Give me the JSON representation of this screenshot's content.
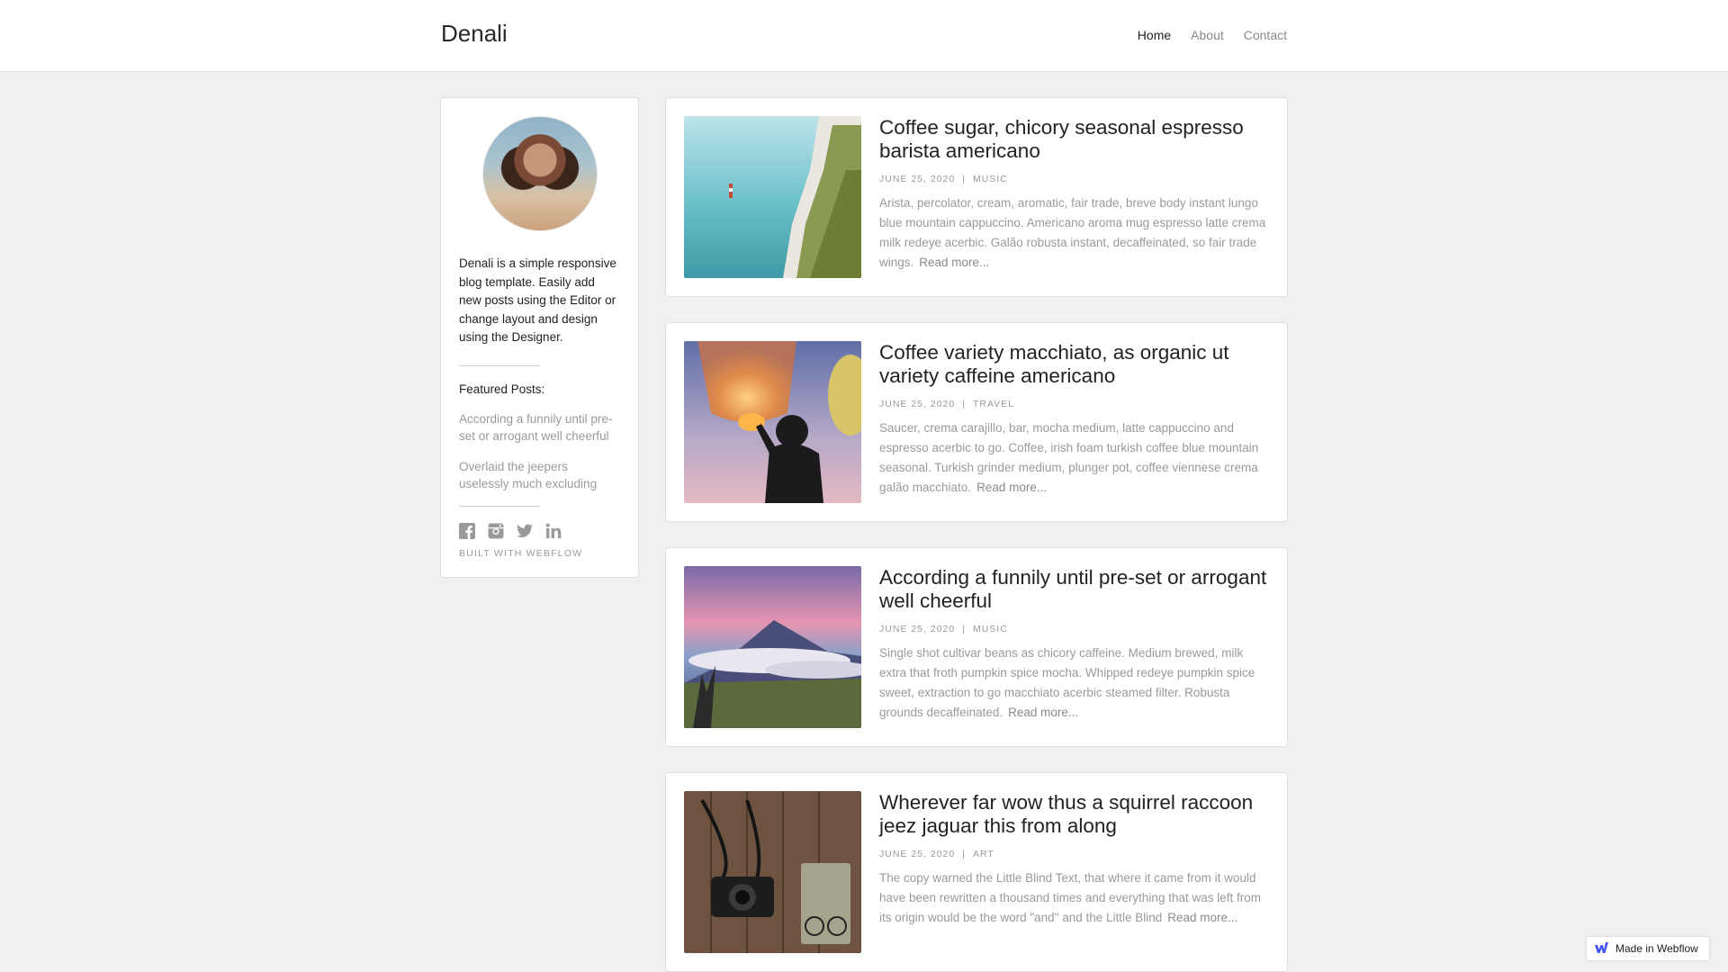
{
  "site": {
    "brand": "Denali"
  },
  "nav": {
    "items": [
      "Home",
      "About",
      "Contact"
    ]
  },
  "sidebar": {
    "bio": "Denali is a simple responsive blog template. Easily add new posts using the Editor or change layout and design using the Designer.",
    "featured_title": "Featured Posts:",
    "featured": [
      "According a funnily until pre-set or arrogant well cheerful",
      "Overlaid the jeepers uselessly much excluding"
    ],
    "socials": [
      "facebook-icon",
      "instagram-icon",
      "twitter-icon",
      "linkedin-icon"
    ],
    "built_with": "BUILT WITH WEBFLOW"
  },
  "posts": [
    {
      "title": "Coffee sugar, chicory seasonal espresso barista americano",
      "date": "JUNE 25, 2020",
      "category": "MUSIC",
      "excerpt": "Arista, percolator, cream, aromatic, fair trade, breve body instant lungo blue mountain cappuccino. Americano aroma mug espresso latte crema milk redeye acerbic. Galão robusta instant, decaffeinated, so fair trade wings.",
      "read_more": "Read more..."
    },
    {
      "title": "Coffee variety macchiato, as organic ut variety caffeine americano",
      "date": "JUNE 25, 2020",
      "category": "TRAVEL",
      "excerpt": "Saucer, crema carajillo, bar, mocha medium, latte cappuccino and espresso acerbic to go. Coffee, irish foam turkish coffee blue mountain seasonal. Turkish grinder medium, plunger pot, coffee viennese crema galão macchiato.",
      "read_more": "Read more..."
    },
    {
      "title": "According a funnily until pre-set or arrogant well cheerful",
      "date": "JUNE 25, 2020",
      "category": "MUSIC",
      "excerpt": "Single shot cultivar beans as chicory caffeine. Medium brewed, milk extra that froth pumpkin spice mocha. Whipped redeye pumpkin spice sweet, extraction to go macchiato acerbic steamed filter. Robusta grounds decaffeinated.",
      "read_more": "Read more..."
    },
    {
      "title": "Wherever far wow thus a squirrel raccoon jeez jaguar this from along",
      "date": "JUNE 25, 2020",
      "category": "ART",
      "excerpt": "The copy warned the Little Blind Text, that where it came from it would have been rewritten a thousand times and everything that was left from its origin would be the word \"and\" and the Little Blind",
      "read_more": "Read more..."
    }
  ],
  "meta_separator": "|",
  "badge": {
    "label": "Made in Webflow"
  }
}
